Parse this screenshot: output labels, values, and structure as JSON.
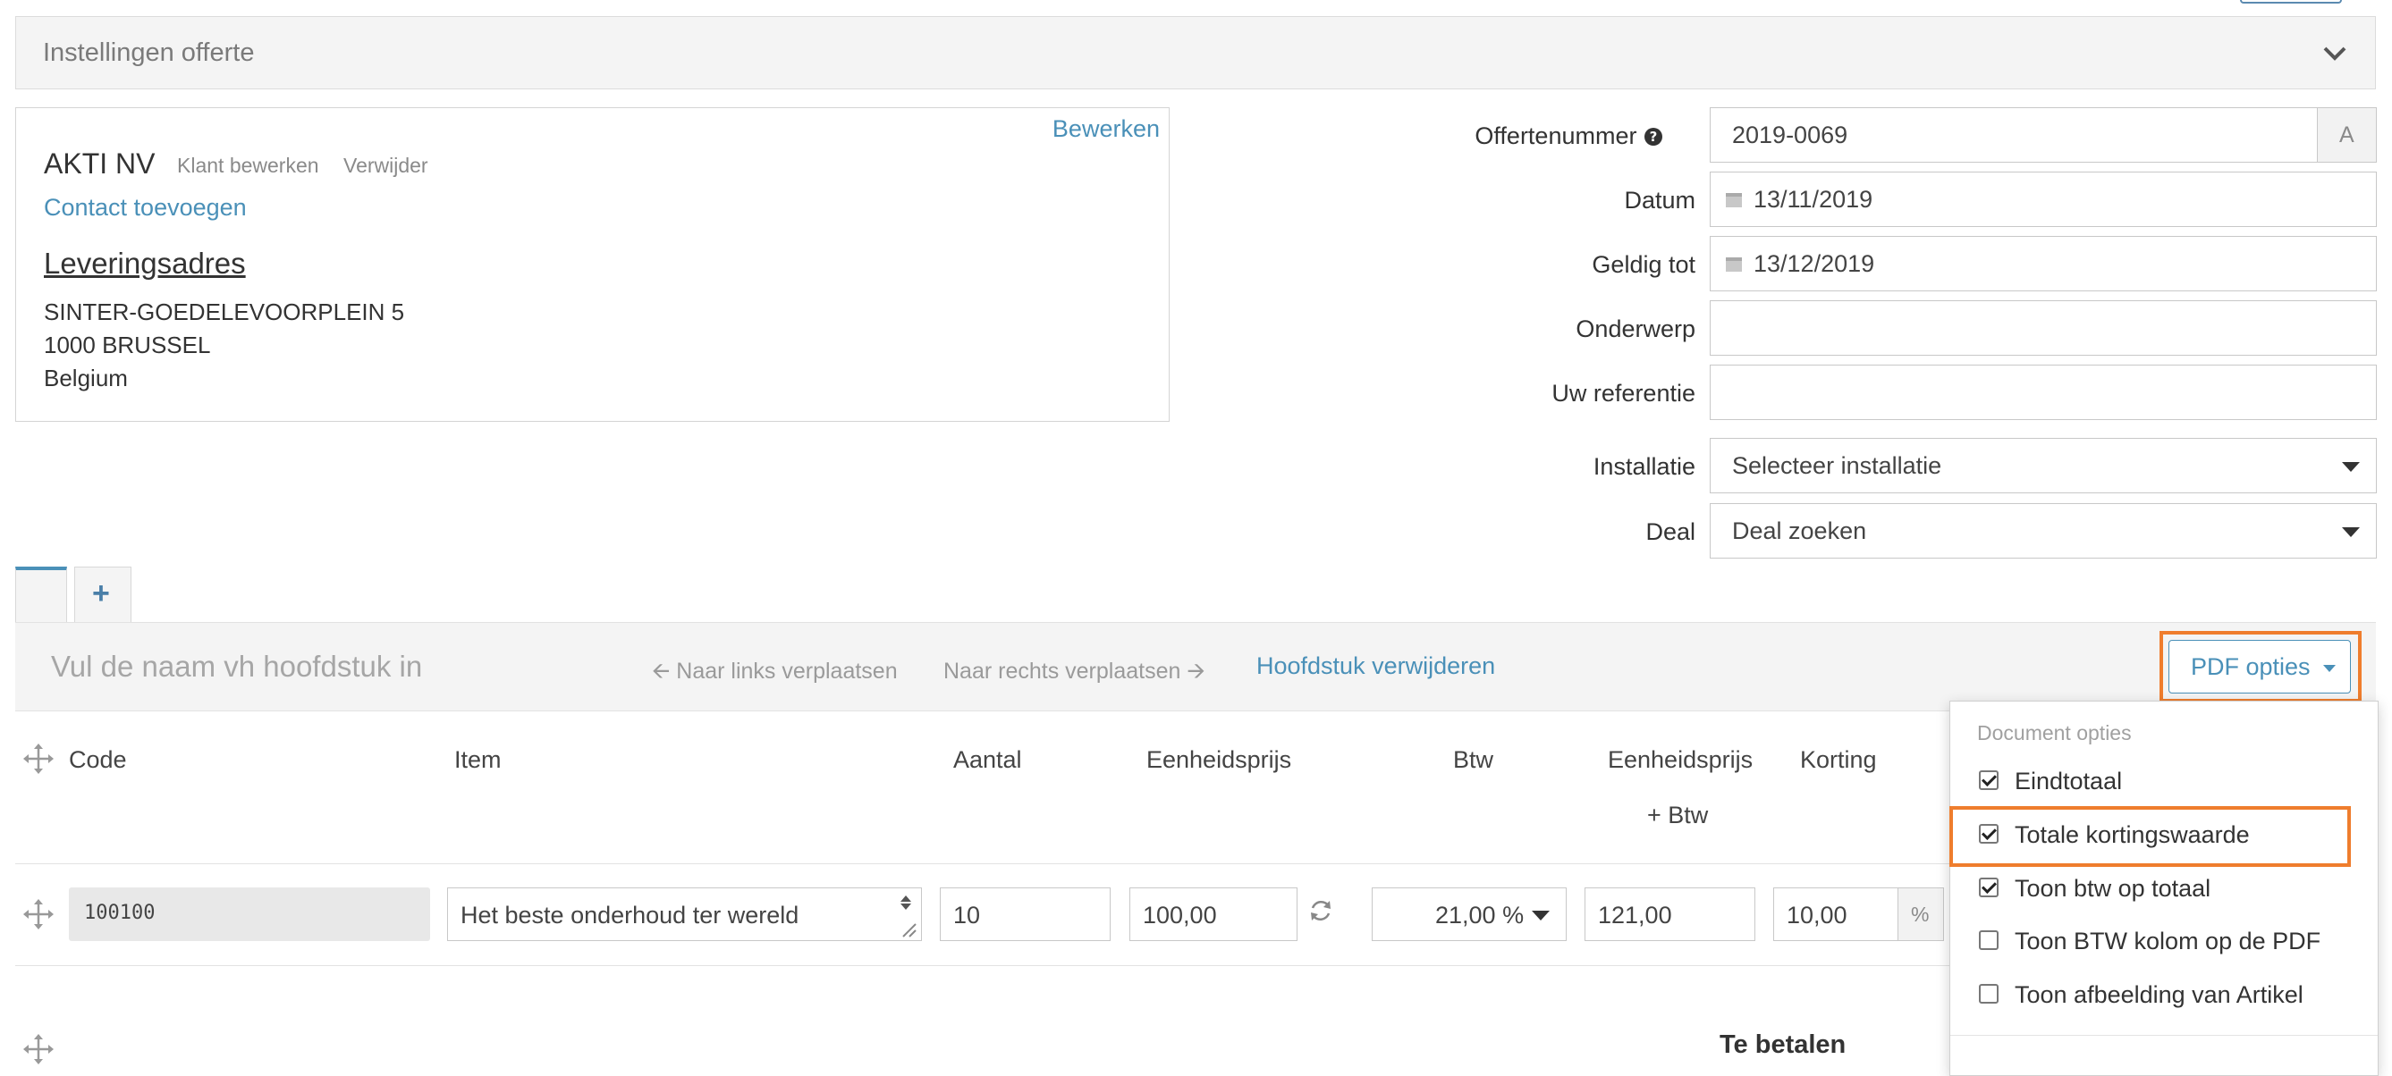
{
  "settings": {
    "title": "Instellingen offerte"
  },
  "customer": {
    "edit_link": "Bewerken",
    "name": "AKTI NV",
    "edit_customer": "Klant bewerken",
    "remove": "Verwijder",
    "add_contact": "Contact toevoegen",
    "delivery_heading": "Leveringsadres",
    "address_lines": [
      "SINTER-GOEDELEVOORPLEIN 5",
      "1000 BRUSSEL",
      "Belgium"
    ]
  },
  "form": {
    "quote_number": {
      "label": "Offertenummer",
      "value": "2019-0069",
      "auto_btn": "A"
    },
    "date": {
      "label": "Datum",
      "value": "13/11/2019"
    },
    "valid_until": {
      "label": "Geldig tot",
      "value": "13/12/2019"
    },
    "subject": {
      "label": "Onderwerp",
      "value": ""
    },
    "reference": {
      "label": "Uw referentie",
      "value": ""
    },
    "installation": {
      "label": "Installatie",
      "value": "Selecteer installatie"
    },
    "deal": {
      "label": "Deal",
      "value": "Deal zoeken"
    }
  },
  "tabs": {
    "add": "+"
  },
  "chapter": {
    "name_placeholder": "Vul de naam vh hoofdstuk in",
    "move_left": "Naar links verplaatsen",
    "move_right": "Naar rechts verplaatsen",
    "delete": "Hoofdstuk verwijderen",
    "pdf_options": "PDF opties"
  },
  "table": {
    "headers": {
      "code": "Code",
      "item": "Item",
      "qty": "Aantal",
      "unit_price": "Eenheidsprijs",
      "vat": "Btw",
      "unit_price_vat_1": "Eenheidsprijs",
      "unit_price_vat_2": "+ Btw",
      "discount": "Korting"
    },
    "row": {
      "code": "100100",
      "item": "Het beste onderhoud ter wereld",
      "qty": "10",
      "unit_price": "100,00",
      "vat": "21,00 %",
      "unit_price_vat": "121,00",
      "discount": "10,00",
      "discount_unit": "%"
    },
    "total_label": "Te betalen"
  },
  "pdf_dropdown": {
    "section": "Document opties",
    "items": [
      {
        "label": "Eindtotaal",
        "checked": true
      },
      {
        "label": "Totale kortingswaarde",
        "checked": true
      },
      {
        "label": "Toon btw op totaal",
        "checked": true
      },
      {
        "label": "Toon BTW kolom op de PDF",
        "checked": false
      },
      {
        "label": "Toon afbeelding van Artikel",
        "checked": false
      }
    ]
  },
  "colors": {
    "highlight": "#ef7d2d",
    "link": "#4a90b8",
    "bar": "#f4f4f4"
  }
}
